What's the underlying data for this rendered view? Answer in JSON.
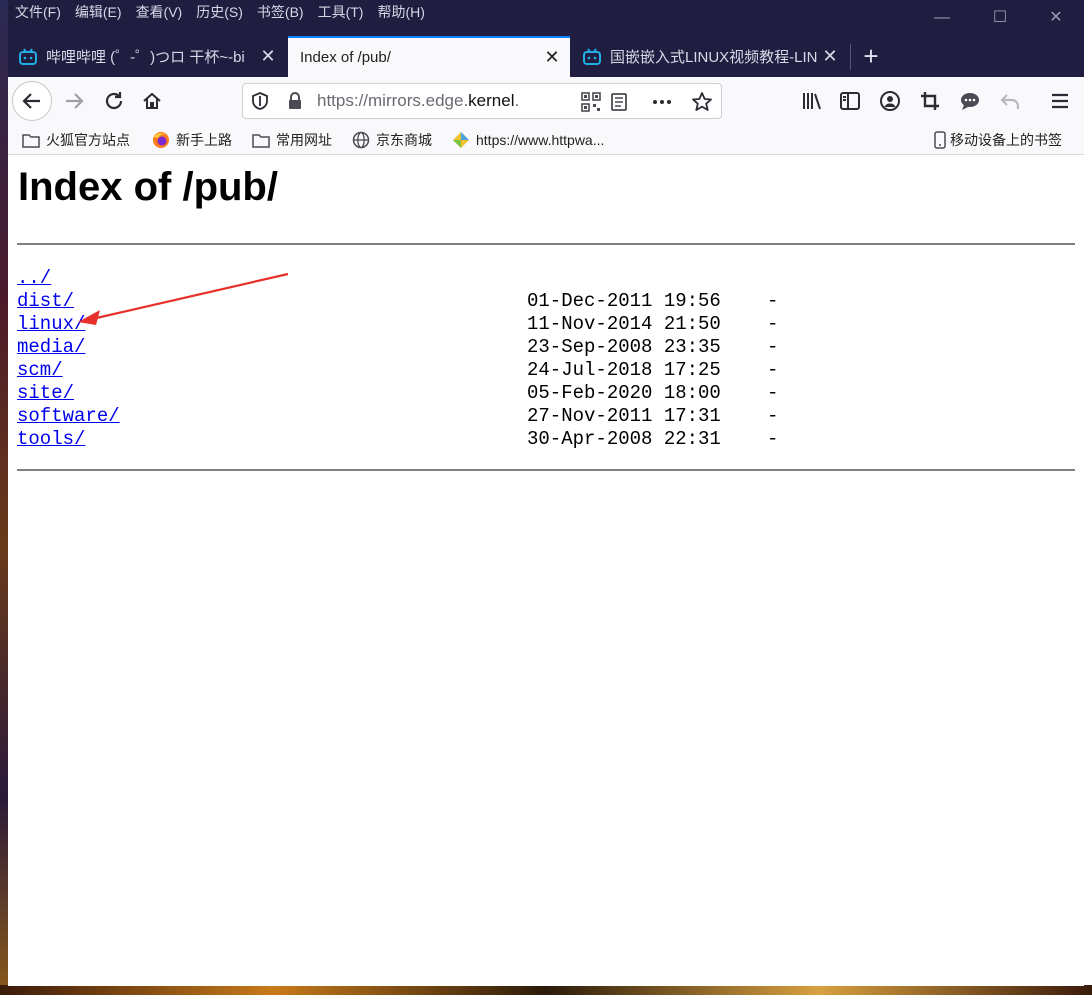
{
  "menu": [
    "文件(F)",
    "编辑(E)",
    "查看(V)",
    "历史(S)",
    "书签(B)",
    "工具(T)",
    "帮助(H)"
  ],
  "window_controls": {
    "minimize": "—",
    "maximize": "☐",
    "close": "✕"
  },
  "tabs": [
    {
      "title": "哔哩哔哩 (゜-゜)つロ 干杯~-bi",
      "active": false
    },
    {
      "title": "Index of /pub/",
      "active": true
    },
    {
      "title": "国嵌嵌入式LINUX视频教程-LIN",
      "active": false
    }
  ],
  "new_tab": "+",
  "url": {
    "prefix": "https://mirrors.edge.",
    "domain": "kernel",
    "suffix": "."
  },
  "bookmarks": [
    "火狐官方站点",
    "新手上路",
    "常用网址",
    "京东商城",
    "https://www.httpwa...",
    "移动设备上的书签"
  ],
  "page": {
    "title": "Index of /pub/",
    "parent": "../",
    "entries": [
      {
        "name": "dist/",
        "date": "01-Dec-2011 19:56",
        "size": "-"
      },
      {
        "name": "linux/",
        "date": "11-Nov-2014 21:50",
        "size": "-"
      },
      {
        "name": "media/",
        "date": "23-Sep-2008 23:35",
        "size": "-"
      },
      {
        "name": "scm/",
        "date": "24-Jul-2018 17:25",
        "size": "-"
      },
      {
        "name": "site/",
        "date": "05-Feb-2020 18:00",
        "size": "-"
      },
      {
        "name": "software/",
        "date": "27-Nov-2011 17:31",
        "size": "-"
      },
      {
        "name": "tools/",
        "date": "30-Apr-2008 22:31",
        "size": "-"
      }
    ]
  },
  "colors": {
    "link": "#0000ee",
    "accent": "#0a84ff",
    "annotation_arrow": "#e8302a",
    "titlebar": "#1f1e40"
  },
  "icons": [
    "bilibili-icon",
    "shield-icon",
    "lock-icon",
    "qr-code-icon",
    "reader-icon",
    "more-icon",
    "star-icon",
    "library-icon",
    "sidebar-icon",
    "account-icon",
    "crop-icon",
    "chat-icon",
    "undo-icon",
    "hamburger-menu-icon",
    "folder-icon",
    "firefox-icon",
    "globe-icon",
    "mobile-icon"
  ]
}
